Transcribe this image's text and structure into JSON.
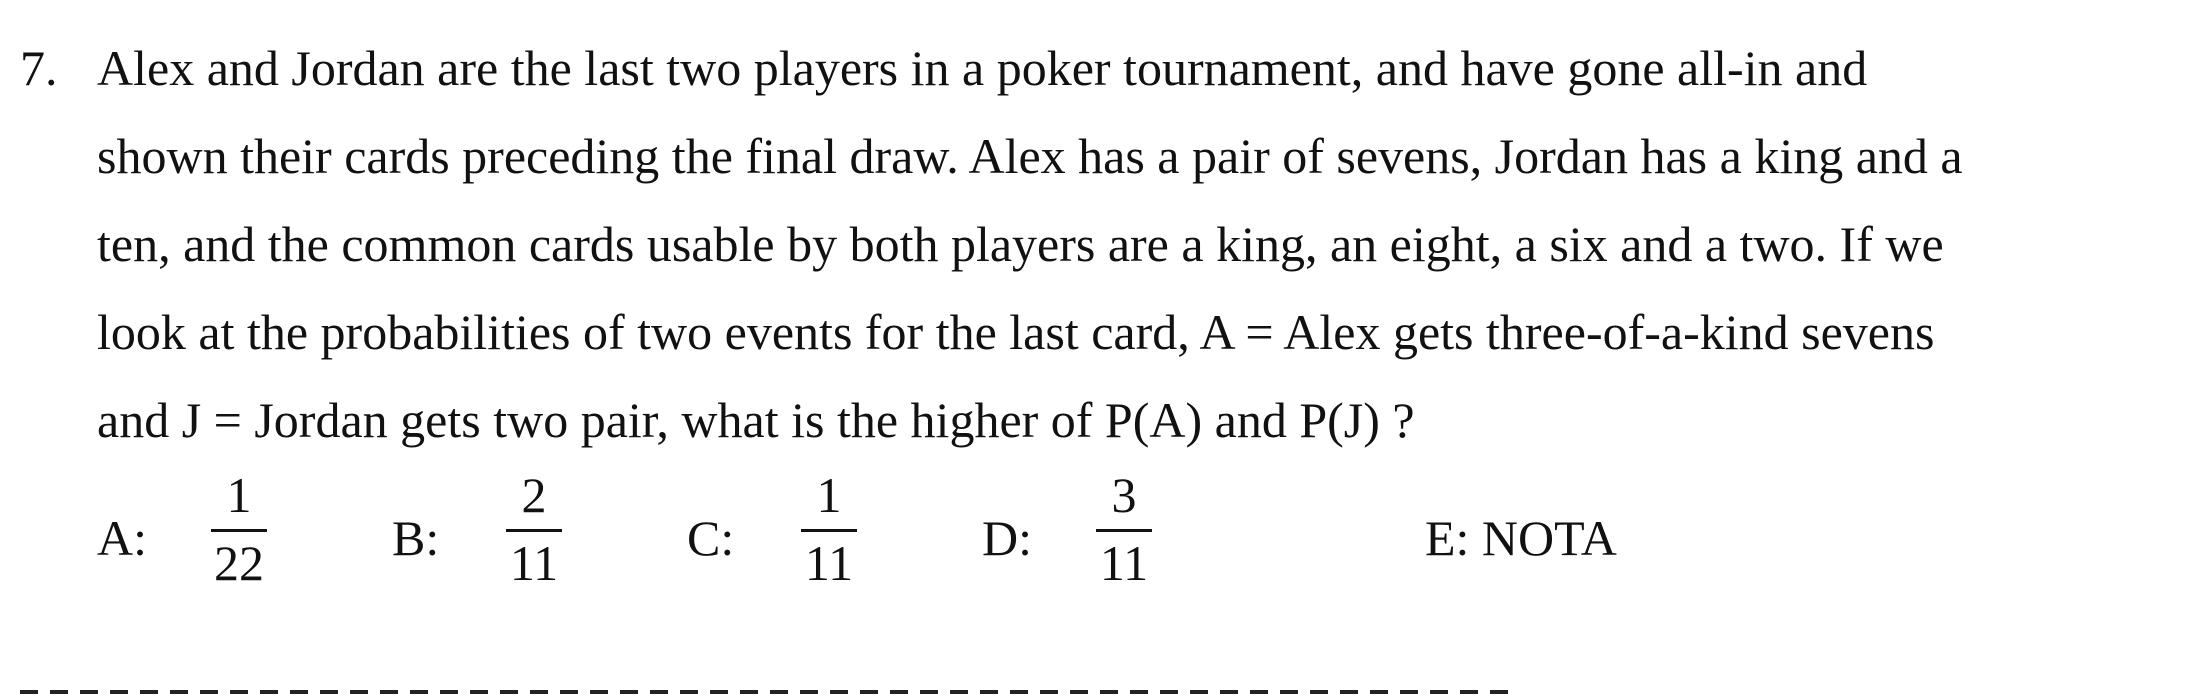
{
  "question": {
    "number": "7.",
    "lines": [
      "Alex and Jordan are the last two players in a poker tournament, and have gone all-in and",
      "shown their cards preceding the final draw.  Alex has a pair of sevens, Jordan has a king and a",
      "ten, and the common cards usable by both players are a king, an eight, a six and a two.  If we",
      "look at the probabilities of two events for the last card, A = Alex gets three-of-a-kind sevens",
      "and J = Jordan gets two pair, what is the higher of P(A) and P(J) ?"
    ]
  },
  "choices": [
    {
      "letter": "A:",
      "numerator": "1",
      "denominator": "22"
    },
    {
      "letter": "B:",
      "numerator": "2",
      "denominator": "11"
    },
    {
      "letter": "C:",
      "numerator": "1",
      "denominator": "11"
    },
    {
      "letter": "D:",
      "numerator": "3",
      "denominator": "11"
    },
    {
      "letter": "E: NOTA"
    }
  ]
}
